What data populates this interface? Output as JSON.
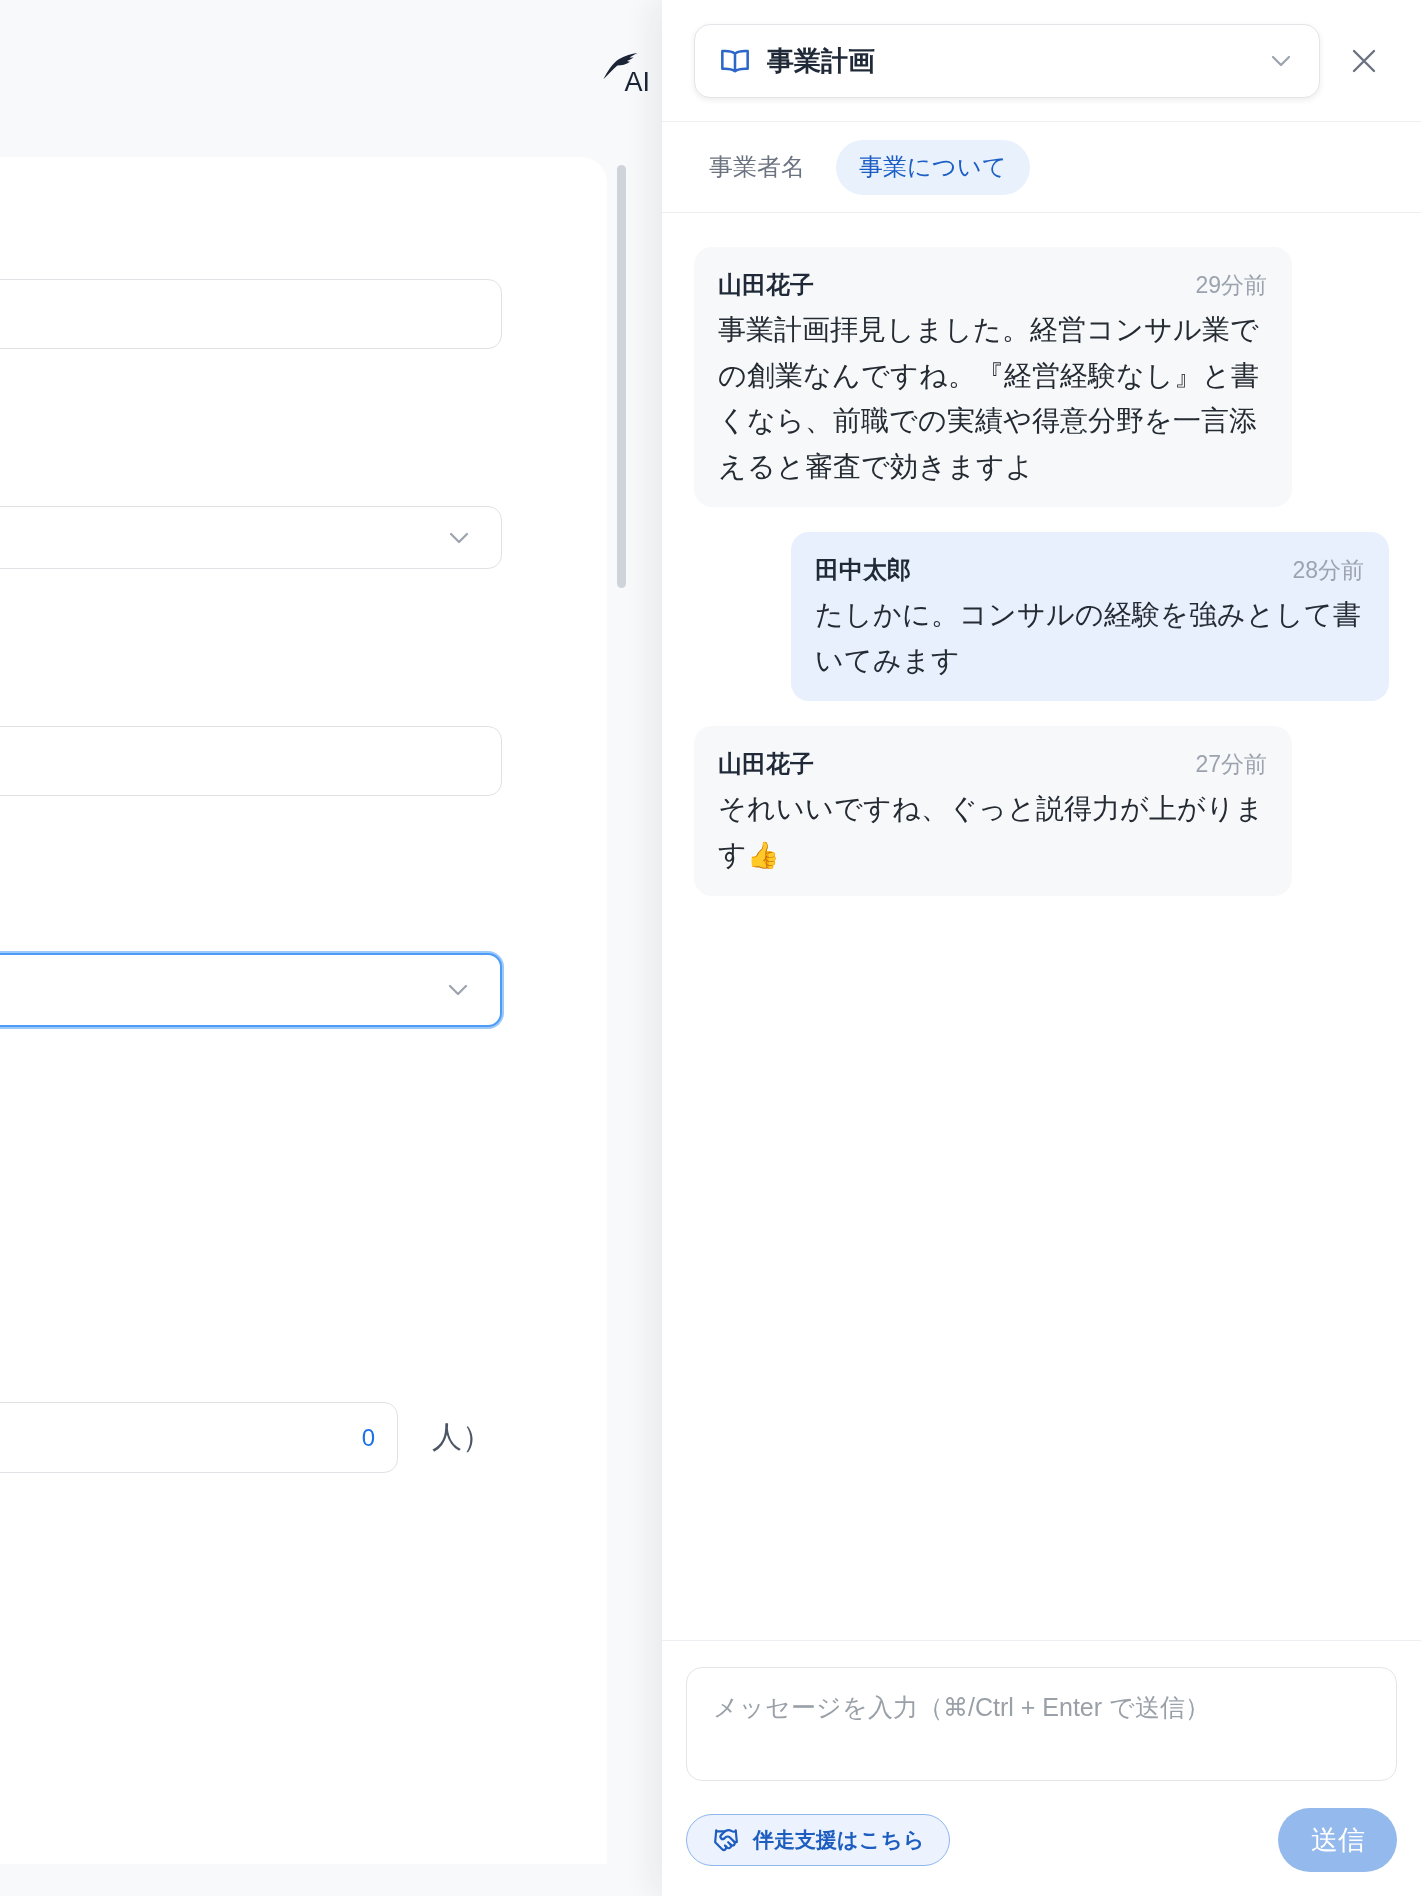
{
  "app_logo": {
    "label": "AI"
  },
  "form": {
    "fields": [
      {
        "kind": "text",
        "focused": false
      },
      {
        "kind": "select",
        "focused": false
      },
      {
        "kind": "text",
        "focused": false
      },
      {
        "kind": "select",
        "focused": true
      },
      {
        "kind": "number",
        "focused": false,
        "value": "0",
        "suffix": "人）"
      }
    ]
  },
  "chat_panel": {
    "document_select": {
      "value": "事業計画"
    },
    "tabs": [
      {
        "label": "事業者名",
        "selected": false
      },
      {
        "label": "事業について",
        "selected": true
      }
    ],
    "messages": [
      {
        "author": "山田花子",
        "time": "29分前",
        "own": false,
        "text": "事業計画拝見しました。経営コンサル業での創業なんですね。『経営経験なし』と書くなら、前職での実績や得意分野を一言添えると審査で効きますよ"
      },
      {
        "author": "田中太郎",
        "time": "28分前",
        "own": true,
        "text": "たしかに。コンサルの経験を強みとして書いてみます"
      },
      {
        "author": "山田花子",
        "time": "27分前",
        "own": false,
        "text": "それいいですね、ぐっと説得力が上がります👍"
      }
    ],
    "composer": {
      "placeholder": "メッセージを入力（⌘/Ctrl + Enter で送信）"
    },
    "support_button": {
      "label": "伴走支援はこちら"
    },
    "send_button": {
      "label": "送信",
      "disabled": true
    }
  }
}
